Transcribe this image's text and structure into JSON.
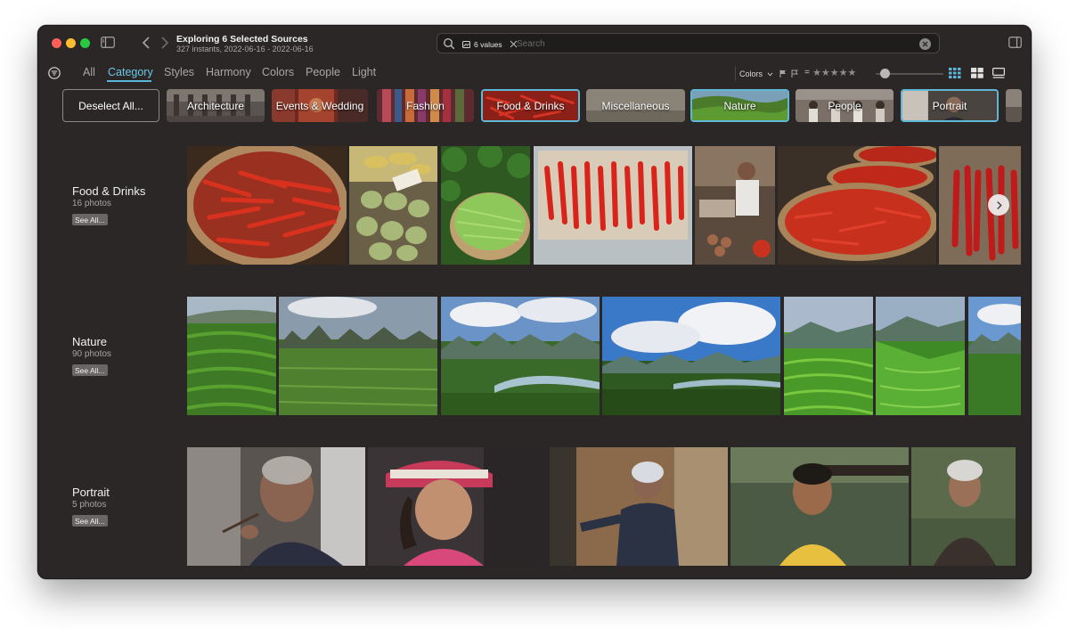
{
  "window": {
    "title": "Exploring 6 Selected Sources",
    "subtitle": "327 instants, 2022-06-16 - 2022-06-16"
  },
  "search": {
    "token_label": "6 values",
    "placeholder": "Search"
  },
  "tabs": [
    {
      "label": "All"
    },
    {
      "label": "Category"
    },
    {
      "label": "Styles"
    },
    {
      "label": "Harmony"
    },
    {
      "label": "Colors"
    },
    {
      "label": "People"
    },
    {
      "label": "Light"
    }
  ],
  "toolbar": {
    "colors_label": "Colors",
    "equals_sign": "=",
    "stars": "★★★★★"
  },
  "chips": {
    "deselect_label": "Deselect All...",
    "items": [
      {
        "label": "Architecture",
        "selected": false
      },
      {
        "label": "Events & Wedding",
        "selected": false
      },
      {
        "label": "Fashion",
        "selected": false
      },
      {
        "label": "Food & Drinks",
        "selected": true
      },
      {
        "label": "Miscellaneous",
        "selected": false
      },
      {
        "label": "Nature",
        "selected": true
      },
      {
        "label": "People",
        "selected": false
      },
      {
        "label": "Portrait",
        "selected": true
      }
    ]
  },
  "sections": [
    {
      "name": "Food & Drinks",
      "count": "16 photos",
      "see_all": "See All..."
    },
    {
      "name": "Nature",
      "count": "90 photos",
      "see_all": "See All..."
    },
    {
      "name": "Portrait",
      "count": "5 photos",
      "see_all": "See All..."
    }
  ],
  "colors": {
    "accent": "#5cb6dc",
    "background": "#2b2727"
  },
  "icons": {
    "sidebar": "sidebar-icon",
    "back": "chevron-left-icon",
    "forward": "chevron-right-icon",
    "search": "search-icon",
    "filter": "filter-icon",
    "flag": "flag-icon",
    "next": "chevron-right-icon"
  }
}
